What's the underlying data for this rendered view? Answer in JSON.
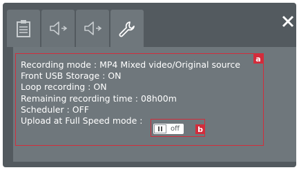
{
  "tabs": [
    {
      "icon": "clipboard-icon",
      "active": false
    },
    {
      "icon": "speaker-left-icon",
      "active": false
    },
    {
      "icon": "speaker-right-icon",
      "active": false
    },
    {
      "icon": "wrench-icon",
      "active": true
    }
  ],
  "close_icon": "close-icon",
  "status": {
    "recording_mode": "Recording mode : MP4 Mixed video/Original source",
    "front_usb": "Front USB Storage : ON",
    "loop_recording": "Loop recording : ON",
    "remaining_time": "Remaining recording time : 08h00m",
    "scheduler": "Scheduler : OFF",
    "upload_label": "Upload at Full Speed mode :"
  },
  "toggle": {
    "state_label": "off",
    "checked": false
  },
  "annotations": {
    "a": "a",
    "b": "b"
  },
  "colors": {
    "frame": "#535a5f",
    "panel": "#6f777c",
    "annotation": "#d32c3b",
    "text": "#ffffff"
  }
}
